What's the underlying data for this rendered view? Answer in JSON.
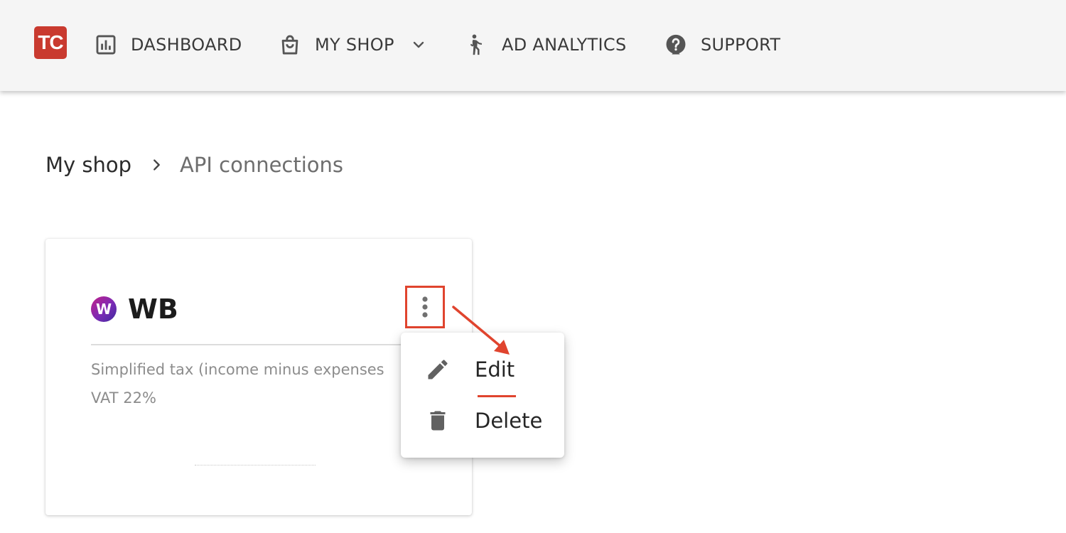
{
  "logo": {
    "text": "TC",
    "color": "#c93a2f"
  },
  "nav": {
    "items": [
      {
        "label": "DASHBOARD",
        "icon": "bar-chart-icon"
      },
      {
        "label": "MY SHOP",
        "icon": "shopping-bag-icon",
        "has_dropdown": true
      },
      {
        "label": "AD ANALYTICS",
        "icon": "person-walking-icon"
      },
      {
        "label": "SUPPORT",
        "icon": "help-circle-icon"
      }
    ]
  },
  "breadcrumb": {
    "root": "My shop",
    "current": "API connections"
  },
  "card": {
    "marketplace_icon": "W",
    "title": "WB",
    "tax_text": "Simplified tax (income minus expenses",
    "vat_text": "VAT 22%"
  },
  "menu": {
    "items": [
      {
        "label": "Edit",
        "icon": "pencil-icon"
      },
      {
        "label": "Delete",
        "icon": "trash-icon"
      }
    ]
  },
  "colors": {
    "annotation": "#e0442e",
    "topbar": "#f5f5f5",
    "icon": "#5f5f5f"
  }
}
